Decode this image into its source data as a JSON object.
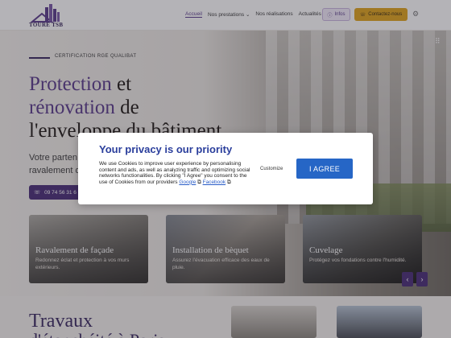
{
  "header": {
    "logo_text": "TOURE TSB",
    "nav": [
      "Accueil",
      "Nos prestations",
      "Nos réalisations",
      "Actualités"
    ],
    "infos_label": "Infos",
    "contact_label": "Contactez-nous"
  },
  "hero": {
    "certification": "CERTIFICATION RGE QUALIBAT",
    "title_accent_1": "Protection",
    "title_rest_1": " et",
    "title_accent_2": "rénovation",
    "title_rest_2": " de",
    "title_line_3": "l'enveloppe du bâtiment",
    "subtitle_1": "Votre parten",
    "subtitle_2": "ravalement d",
    "phone": "09 74 56 31 6"
  },
  "services": [
    {
      "title": "Ravalement de façade",
      "desc": "Redonnez éclat et protection à vos murs extérieurs."
    },
    {
      "title": "Installation de bèquet",
      "desc": "Assurez l'évacuation efficace des eaux de pluie."
    },
    {
      "title": "Cuvelage",
      "desc": "Protégez vos fondations contre l'humidité."
    }
  ],
  "section2": {
    "title_1": "Travaux",
    "title_2": "d'étanchéité à Paris"
  },
  "cookie": {
    "title": "Your privacy is our priority",
    "body": "We use Cookies to improve user experience by personalising content and ads, as well as analyzing traffic and optimizing social networks functionalities. By clicking \"I Agree\" you consent to the use of Cookies from our providers",
    "link_google": "Google",
    "link_facebook": "Facebook",
    "customize_label": "Customize",
    "agree_label": "I AGREE"
  },
  "colors": {
    "brand_purple": "#5b3d8c",
    "accent_yellow": "#e0a51e",
    "cookie_blue": "#2666c6"
  }
}
